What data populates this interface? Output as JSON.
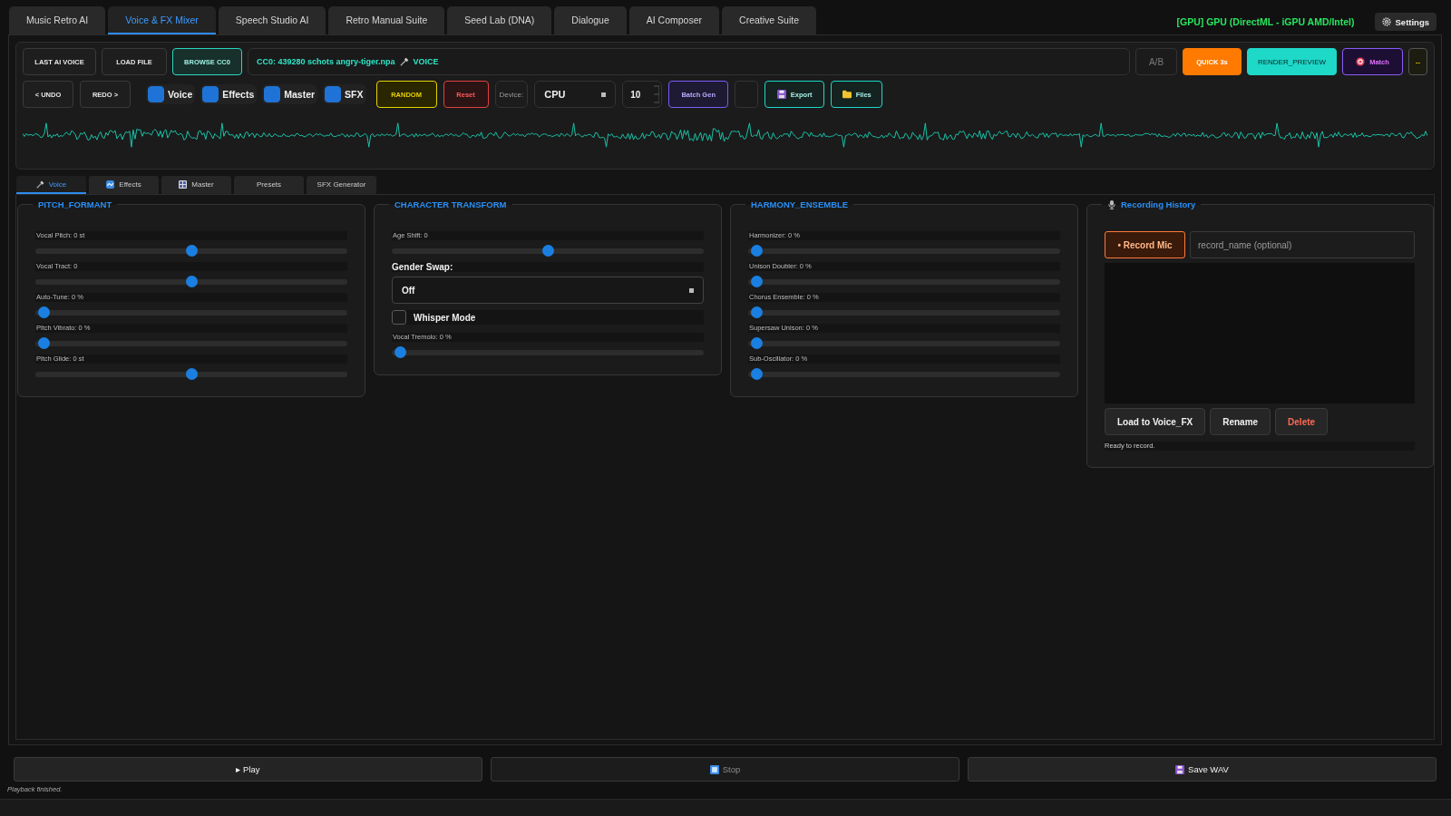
{
  "app_tabs": [
    {
      "label": "Music Retro AI",
      "selected": false
    },
    {
      "label": "Voice & FX Mixer",
      "selected": true
    },
    {
      "label": "Speech Studio AI",
      "selected": false
    },
    {
      "label": "Retro Manual Suite",
      "selected": false
    },
    {
      "label": "Seed Lab (DNA)",
      "selected": false
    },
    {
      "label": "Dialogue",
      "selected": false
    },
    {
      "label": "AI Composer",
      "selected": false
    },
    {
      "label": "Creative Suite",
      "selected": false
    }
  ],
  "gpu_status": "[GPU] GPU (DirectML - iGPU AMD/Intel)",
  "settings_button": "Settings",
  "toolbar": {
    "source_buttons": [
      {
        "label": "LAST AI VOICE",
        "kind": "plain"
      },
      {
        "label": "LOAD FILE",
        "kind": "plain"
      },
      {
        "label": "BROWSE CC0",
        "kind": "accent"
      }
    ],
    "source_file": "CC0: 439280 schots angry-tiger.npa",
    "source_target": "VOICE",
    "action_buttons": [
      {
        "label": "A/B",
        "kind": "muted"
      },
      {
        "label": "QUICK 3s",
        "kind": "warn"
      },
      {
        "label": "RENDER_PREVIEW",
        "kind": "fill"
      },
      {
        "label": "Match",
        "kind": "magic"
      },
      {
        "label": "--",
        "kind": "caution"
      }
    ],
    "history_buttons": [
      "< UNDO",
      "REDO >"
    ],
    "channels": [
      {
        "label": "Voice",
        "checked": true
      },
      {
        "label": "Effects",
        "checked": true
      },
      {
        "label": "Master",
        "checked": true
      },
      {
        "label": "SFX",
        "checked": true
      }
    ],
    "random_button": "RANDOM",
    "reset_button": "Reset",
    "device_label": "Device:",
    "device": "CPU",
    "batch_count": "10",
    "batch_button": "Batch Gen",
    "export_button": "Export",
    "files_button": "Files"
  },
  "sub_tabs": [
    {
      "label": "Voice",
      "selected": true
    },
    {
      "label": "Effects",
      "selected": false
    },
    {
      "label": "Master",
      "selected": false
    },
    {
      "label": "Presets",
      "selected": false
    },
    {
      "label": "SFX Generator",
      "selected": false
    }
  ],
  "panels": [
    {
      "title": "PITCH_FORMANT",
      "controls": [
        {
          "kind": "slider",
          "label": "Vocal Pitch: 0 st",
          "level": 0.5
        },
        {
          "kind": "slider",
          "label": "Vocal Tract: 0",
          "level": 0.5
        },
        {
          "kind": "slider",
          "label": "Auto-Tune: 0 %",
          "level": 0
        },
        {
          "kind": "slider",
          "label": "Pitch Vibrato: 0 %",
          "level": 0
        },
        {
          "kind": "slider",
          "label": "Pitch Glide: 0 st",
          "level": 0.5
        }
      ]
    },
    {
      "title": "CHARACTER TRANSFORM",
      "controls": [
        {
          "kind": "slider",
          "label": "Age Shift: 0",
          "level": 0.5
        },
        {
          "kind": "select",
          "label": "Gender Swap:",
          "value": "Off"
        },
        {
          "kind": "checkbox",
          "label": "Whisper Mode",
          "checked": false
        },
        {
          "kind": "slider",
          "label": "Vocal Tremolo: 0 %",
          "level": 0
        }
      ]
    },
    {
      "title": "HARMONY_ENSEMBLE",
      "controls": [
        {
          "kind": "slider",
          "label": "Harmonizer: 0 %",
          "level": 0
        },
        {
          "kind": "slider",
          "label": "Unison Doubler: 0 %",
          "level": 0
        },
        {
          "kind": "slider",
          "label": "Chorus Ensemble: 0 %",
          "level": 0
        },
        {
          "kind": "slider",
          "label": "Supersaw Unison: 0 %",
          "level": 0
        },
        {
          "kind": "slider",
          "label": "Sub-Oscillator: 0 %",
          "level": 0
        }
      ]
    }
  ],
  "recording_history": {
    "title": "Recording History",
    "record_button": "• Record Mic",
    "name_placeholder": "record_name (optional)",
    "buttons": [
      {
        "label": "Load to Voice_FX",
        "kind": "plain"
      },
      {
        "label": "Rename",
        "kind": "plain"
      },
      {
        "label": "Delete",
        "kind": "danger"
      }
    ],
    "status": "Ready to record."
  },
  "transport": [
    {
      "label": "▸ Play",
      "kind": "play",
      "disabled": false
    },
    {
      "label": "Stop",
      "kind": "stop",
      "disabled": true
    },
    {
      "label": "Save WAV",
      "kind": "save",
      "disabled": false
    }
  ],
  "status_message": "Playback finished."
}
